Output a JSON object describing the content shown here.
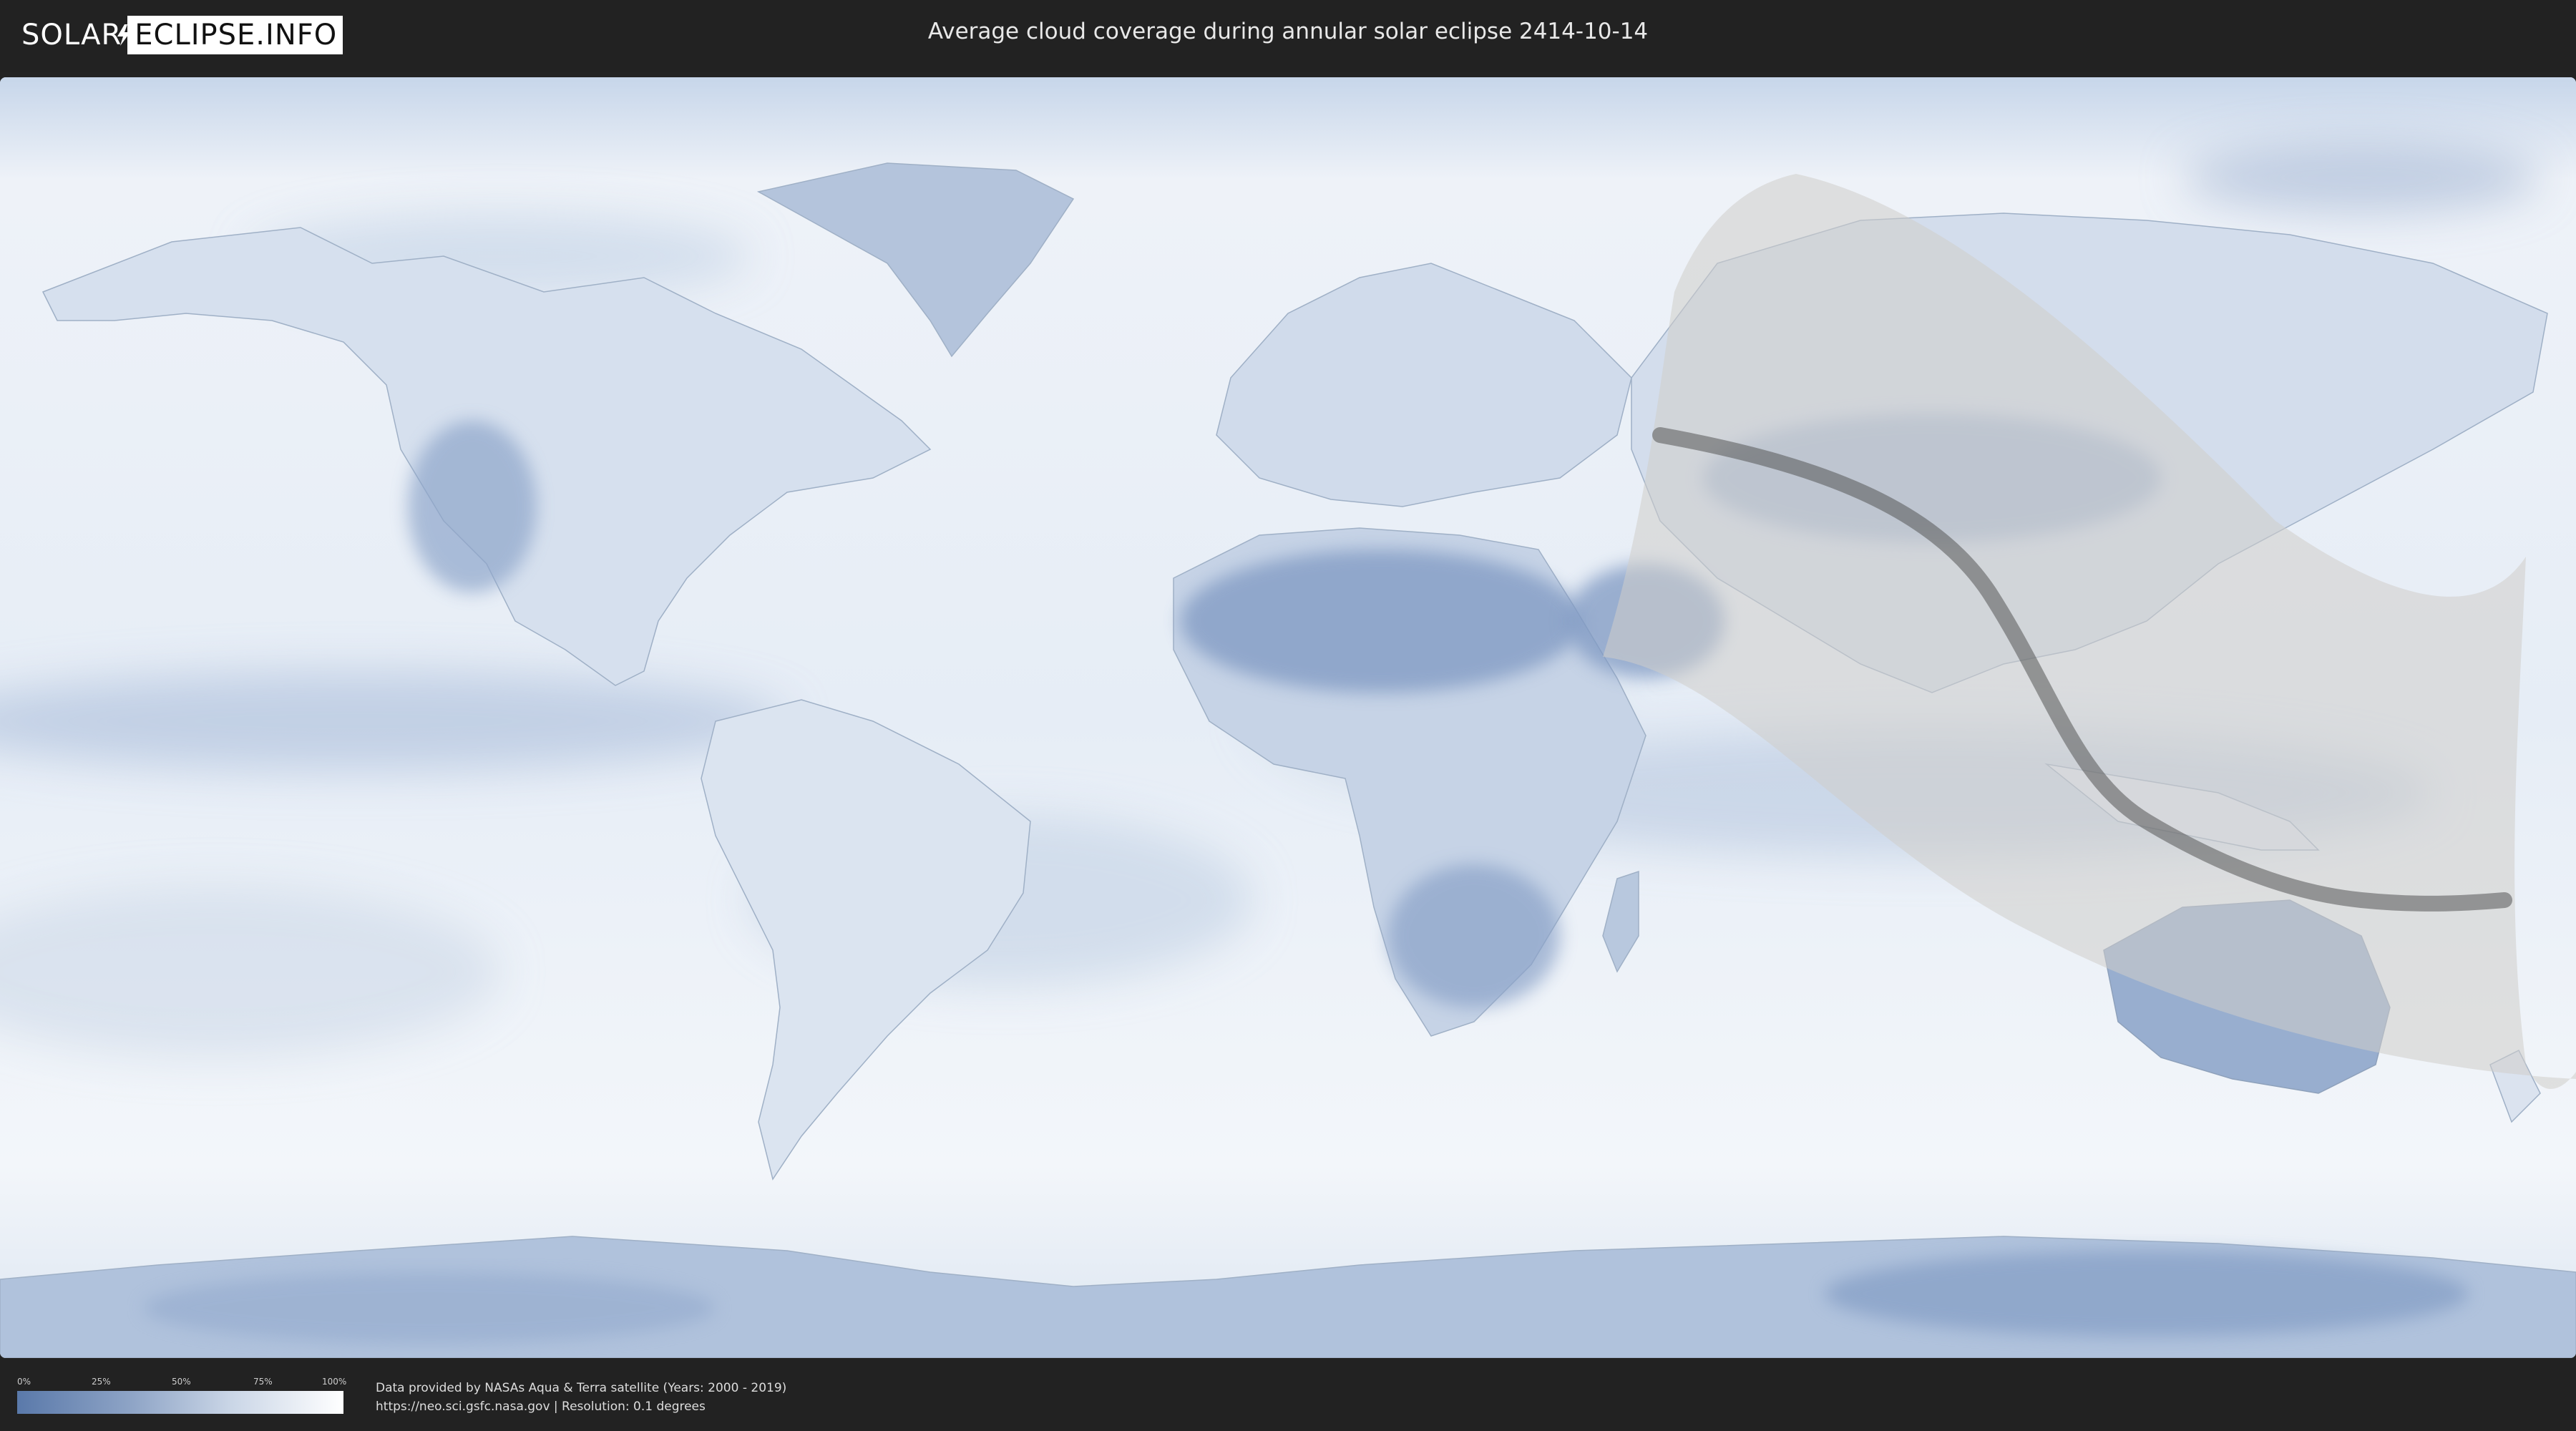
{
  "header": {
    "logo_left": "SOLAR",
    "logo_right": "ECLIPSE.INFO",
    "title": "Average cloud coverage during annular solar eclipse 2414-10-14"
  },
  "legend": {
    "ticks": [
      "0%",
      "25%",
      "50%",
      "75%",
      "100%"
    ],
    "gradient_colors": [
      "#5a79aa",
      "#8ea4c6",
      "#c9d5e6",
      "#ffffff"
    ]
  },
  "footer": {
    "credit_line": "Data provided by NASAs Aqua & Terra satellite (Years: 2000 - 2019)",
    "source_line": "https://neo.sci.gsfc.nasa.gov | Resolution: 0.1 degrees"
  },
  "map": {
    "projection": "equirectangular",
    "overlay_colors": {
      "penumbra": "#cfcdca",
      "central_path": "#555555",
      "clear_sky": "#5f80b3",
      "cloudy": "#f4f6f9"
    }
  },
  "icons": {
    "logo": "lightning-bolt-icon"
  }
}
